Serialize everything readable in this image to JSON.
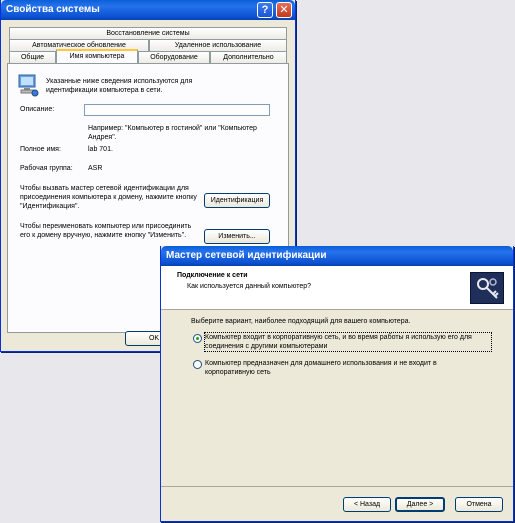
{
  "sysprops": {
    "title": "Свойства системы",
    "help_glyph": "?",
    "close_glyph": "✕",
    "tabs_row1": [
      "Восстановление системы"
    ],
    "tabs_row2": [
      "Автоматическое обновление",
      "Удаленное использование"
    ],
    "tabs_row3": [
      "Общие",
      "Имя компьютера",
      "Оборудование",
      "Дополнительно"
    ],
    "intro": "Указанные ниже сведения используются для идентификации компьютера в сети.",
    "desc_label": "Описание:",
    "desc_value": "",
    "example": "Например: \"Компьютер в гостиной\" или \"Компьютер Андрея\".",
    "fullname_label": "Полное имя:",
    "fullname_value": "lab 701.",
    "workgroup_label": "Рабочая группа:",
    "workgroup_value": "ASR",
    "wizard_text": "Чтобы вызвать мастер сетевой идентификации для присоединения компьютера к домену, нажмите кнопку \"Идентификация\".",
    "ident_button": "Идентификация",
    "rename_text": "Чтобы переименовать компьютер или присоединить его к домену вручную, нажмите кнопку \"Изменить\".",
    "change_button": "Изменить...",
    "ok_button": "OK"
  },
  "wizard": {
    "title": "Мастер сетевой идентификации",
    "heading": "Подключение к сети",
    "subheading": "Как используется данный компьютер?",
    "prompt": "Выберите вариант, наиболее подходящий для вашего компьютера.",
    "options": [
      {
        "label": "Компьютер входит в корпоративную сеть, и во время работы я использую его для соединения с другими компьютерами",
        "selected": true
      },
      {
        "label": "Компьютер предназначен для домашнего использования и не входит в корпоративную сеть",
        "selected": false
      }
    ],
    "back_button": "< Назад",
    "next_button": "Далее >",
    "cancel_button": "Отмена"
  }
}
